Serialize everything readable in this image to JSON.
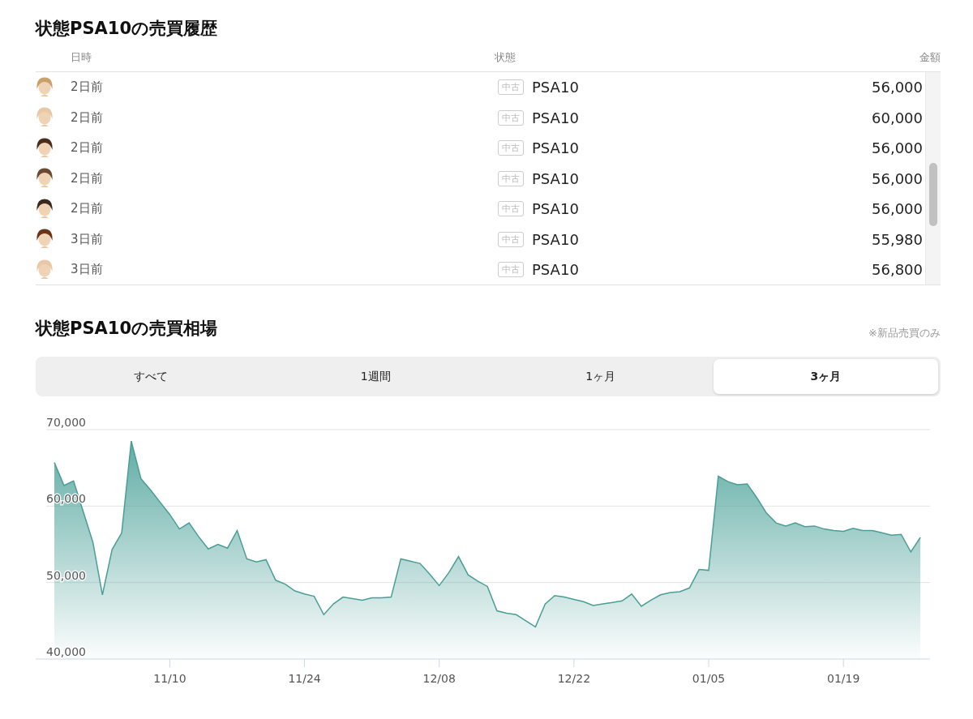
{
  "history": {
    "title": "状態PSA10の売買履歴",
    "columns": [
      "日時",
      "状態",
      "金額"
    ],
    "rows": [
      {
        "color": "#c9a06a",
        "time": "2日前",
        "badge": "中古",
        "condition": "PSA10",
        "price": "56,000"
      },
      {
        "color": "#e8c8a8",
        "time": "2日前",
        "badge": "中古",
        "condition": "PSA10",
        "price": "60,000"
      },
      {
        "color": "#4a2e1c",
        "time": "2日前",
        "badge": "中古",
        "condition": "PSA10",
        "price": "56,000"
      },
      {
        "color": "#6b4a35",
        "time": "2日前",
        "badge": "中古",
        "condition": "PSA10",
        "price": "56,000"
      },
      {
        "color": "#3b2a1e",
        "time": "2日前",
        "badge": "中古",
        "condition": "PSA10",
        "price": "56,000"
      },
      {
        "color": "#6a3418",
        "time": "3日前",
        "badge": "中古",
        "condition": "PSA10",
        "price": "55,980"
      },
      {
        "color": "#e8c8a8",
        "time": "3日前",
        "badge": "中古",
        "condition": "PSA10",
        "price": "56,800"
      }
    ]
  },
  "market": {
    "title": "状態PSA10の売買相場",
    "note": "※新品売買のみ",
    "tabs": [
      {
        "label": "すべて",
        "selected": false
      },
      {
        "label": "1週間",
        "selected": false
      },
      {
        "label": "1ヶ月",
        "selected": false
      },
      {
        "label": "3ヶ月",
        "selected": true
      }
    ],
    "chart_data": {
      "type": "area",
      "ylim": [
        40000,
        70000
      ],
      "yticks": [
        {
          "value": 40000,
          "label": "40,000"
        },
        {
          "value": 50000,
          "label": "50,000"
        },
        {
          "value": 60000,
          "label": "60,000"
        },
        {
          "value": 70000,
          "label": "70,000"
        }
      ],
      "categories": [
        null,
        null,
        null,
        null,
        null,
        null,
        null,
        null,
        null,
        null,
        null,
        null,
        "11/10",
        null,
        null,
        null,
        null,
        null,
        null,
        null,
        null,
        null,
        null,
        null,
        null,
        null,
        "11/24",
        null,
        null,
        null,
        null,
        null,
        null,
        null,
        null,
        null,
        null,
        null,
        null,
        null,
        "12/08",
        null,
        null,
        null,
        null,
        null,
        null,
        null,
        null,
        null,
        null,
        null,
        null,
        null,
        "12/22",
        null,
        null,
        null,
        null,
        null,
        null,
        null,
        null,
        null,
        null,
        null,
        null,
        null,
        "01/05",
        null,
        null,
        null,
        null,
        null,
        null,
        null,
        null,
        null,
        null,
        null,
        null,
        null,
        "01/19",
        null,
        null,
        null,
        null,
        null,
        null,
        null,
        null
      ],
      "values": [
        65700,
        62700,
        63300,
        59300,
        55300,
        48400,
        54300,
        56500,
        68500,
        63600,
        62100,
        60500,
        58900,
        57000,
        57800,
        56000,
        54400,
        55000,
        54500,
        56800,
        53100,
        52700,
        53000,
        50300,
        49800,
        48900,
        48500,
        48200,
        45800,
        47200,
        48100,
        47900,
        47700,
        48000,
        48000,
        48100,
        53100,
        52800,
        52500,
        51100,
        49600,
        51300,
        53400,
        51000,
        50200,
        49500,
        46300,
        46000,
        45800,
        45000,
        44200,
        47200,
        48300,
        48100,
        47800,
        47500,
        47000,
        47200,
        47400,
        47600,
        48500,
        46900,
        47700,
        48400,
        48700,
        48800,
        49300,
        51700,
        51600,
        63900,
        63200,
        62800,
        62900,
        61100,
        59100,
        57800,
        57400,
        57800,
        57300,
        57400,
        57000,
        56800,
        56700,
        57100,
        56800,
        56800,
        56500,
        56200,
        56300,
        54000,
        55900
      ]
    }
  }
}
